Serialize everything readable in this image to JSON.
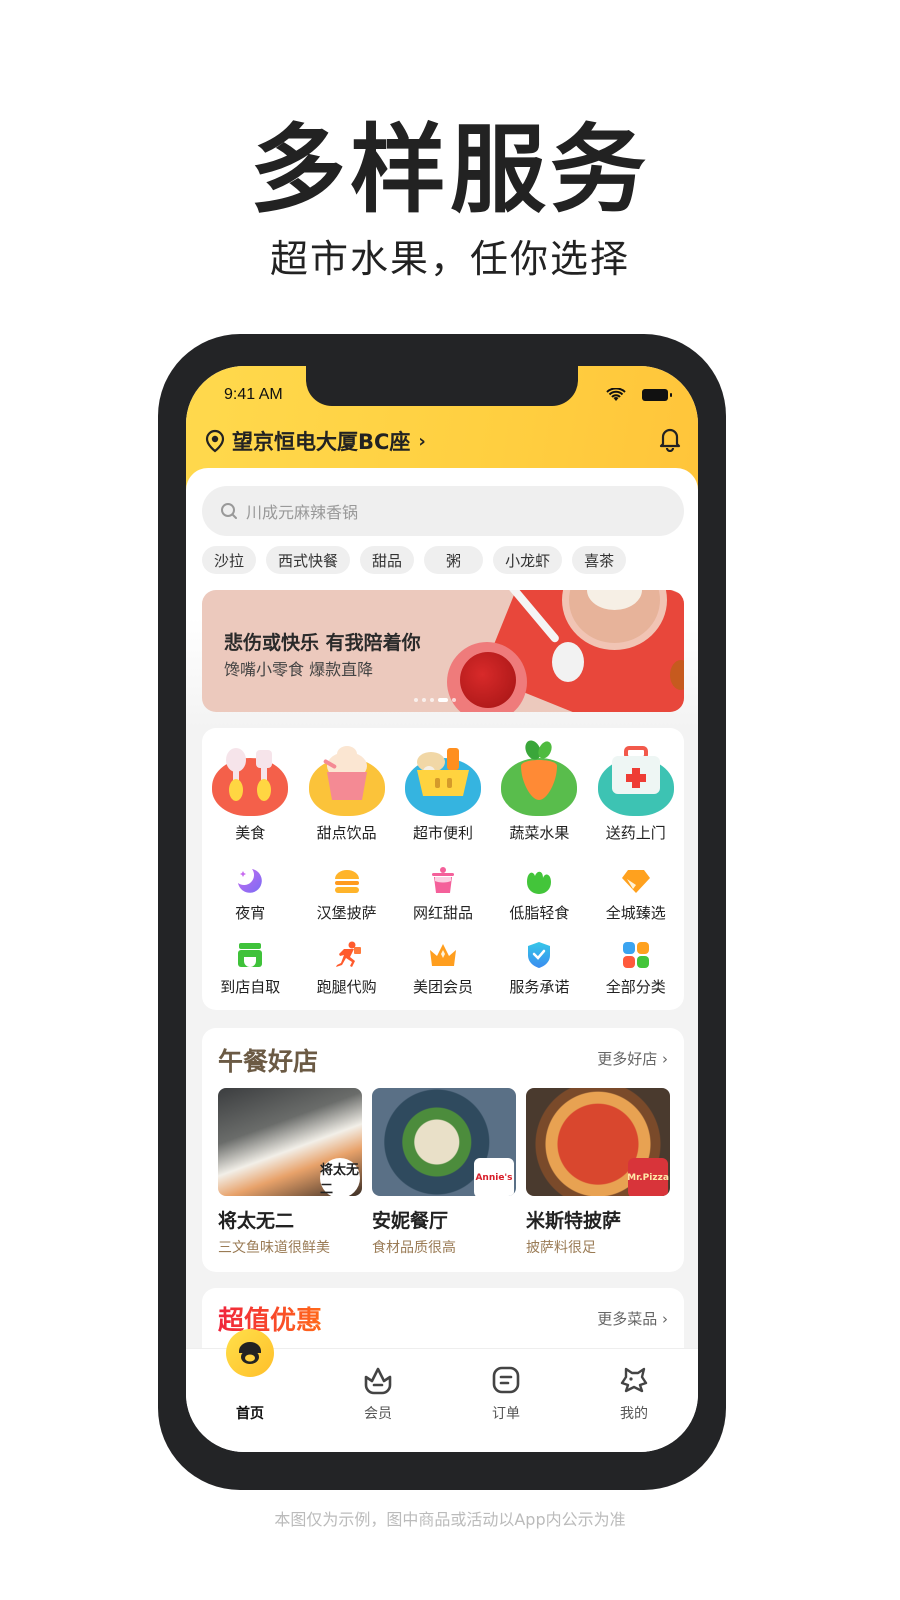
{
  "hero": {
    "title": "多样服务",
    "subtitle": "超市水果，任你选择"
  },
  "status_bar": {
    "time": "9:41 AM"
  },
  "header": {
    "location": "望京恒电大厦BC座",
    "location_arrow": "›"
  },
  "search": {
    "placeholder": "川成元麻辣香锅"
  },
  "chips": [
    "沙拉",
    "西式快餐",
    "甜品",
    "粥",
    "小龙虾",
    "喜茶"
  ],
  "banner": {
    "title": "悲伤或快乐 有我陪着你",
    "subtitle": "馋嘴小零食 爆款直降",
    "slide_count": 5,
    "active_slide": 4
  },
  "big_categories": [
    {
      "label": "美食",
      "icon": "cutlery-icon",
      "color": "#f4604a"
    },
    {
      "label": "甜点饮品",
      "icon": "ice-cream-icon",
      "color": "#fbc33a"
    },
    {
      "label": "超市便利",
      "icon": "basket-icon",
      "color": "#35b4e0"
    },
    {
      "label": "蔬菜水果",
      "icon": "carrot-icon",
      "color": "#59bd4c"
    },
    {
      "label": "送药上门",
      "icon": "medical-kit-icon",
      "color": "#3dc3b3"
    }
  ],
  "small_categories_row1": [
    {
      "label": "夜宵",
      "icon": "moon-icon",
      "color": "#9b6cf2"
    },
    {
      "label": "汉堡披萨",
      "icon": "burger-icon",
      "color": "#ffa723"
    },
    {
      "label": "网红甜品",
      "icon": "dessert-cup-icon",
      "color": "#f4609a"
    },
    {
      "label": "低脂轻食",
      "icon": "leaf-icon",
      "color": "#43c53a"
    },
    {
      "label": "全城臻选",
      "icon": "diamond-icon",
      "color": "#ffa11e"
    }
  ],
  "small_categories_row2": [
    {
      "label": "到店自取",
      "icon": "store-icon",
      "color": "#3fc23a"
    },
    {
      "label": "跑腿代购",
      "icon": "runner-icon",
      "color": "#ff5a2c"
    },
    {
      "label": "美团会员",
      "icon": "crown-icon",
      "color": "#ff9e1e"
    },
    {
      "label": "服务承诺",
      "icon": "shield-check-icon",
      "color": "#3ba4f0"
    },
    {
      "label": "全部分类",
      "icon": "grid-icon",
      "color": "#3ba4f0"
    }
  ],
  "lunch": {
    "title": "午餐好店",
    "more": "更多好店 ›",
    "shops": [
      {
        "name": "将太无二",
        "desc": "三文鱼味道很鲜美",
        "logo": "将太无二"
      },
      {
        "name": "安妮餐厅",
        "desc": "食材品质很高",
        "logo": "Annie's"
      },
      {
        "name": "米斯特披萨",
        "desc": "披萨料很足",
        "logo": "Mr.Pizza"
      }
    ]
  },
  "deals": {
    "title": "超值优惠",
    "more": "更多菜品 ›"
  },
  "tabbar": [
    {
      "label": "首页",
      "icon": "home-mascot-icon",
      "active": true
    },
    {
      "label": "会员",
      "icon": "crown-outline-icon",
      "active": false
    },
    {
      "label": "订单",
      "icon": "order-icon",
      "active": false
    },
    {
      "label": "我的",
      "icon": "profile-mascot-icon",
      "active": false
    }
  ],
  "footnote": "本图仅为示例，图中商品或活动以App内公示为准"
}
